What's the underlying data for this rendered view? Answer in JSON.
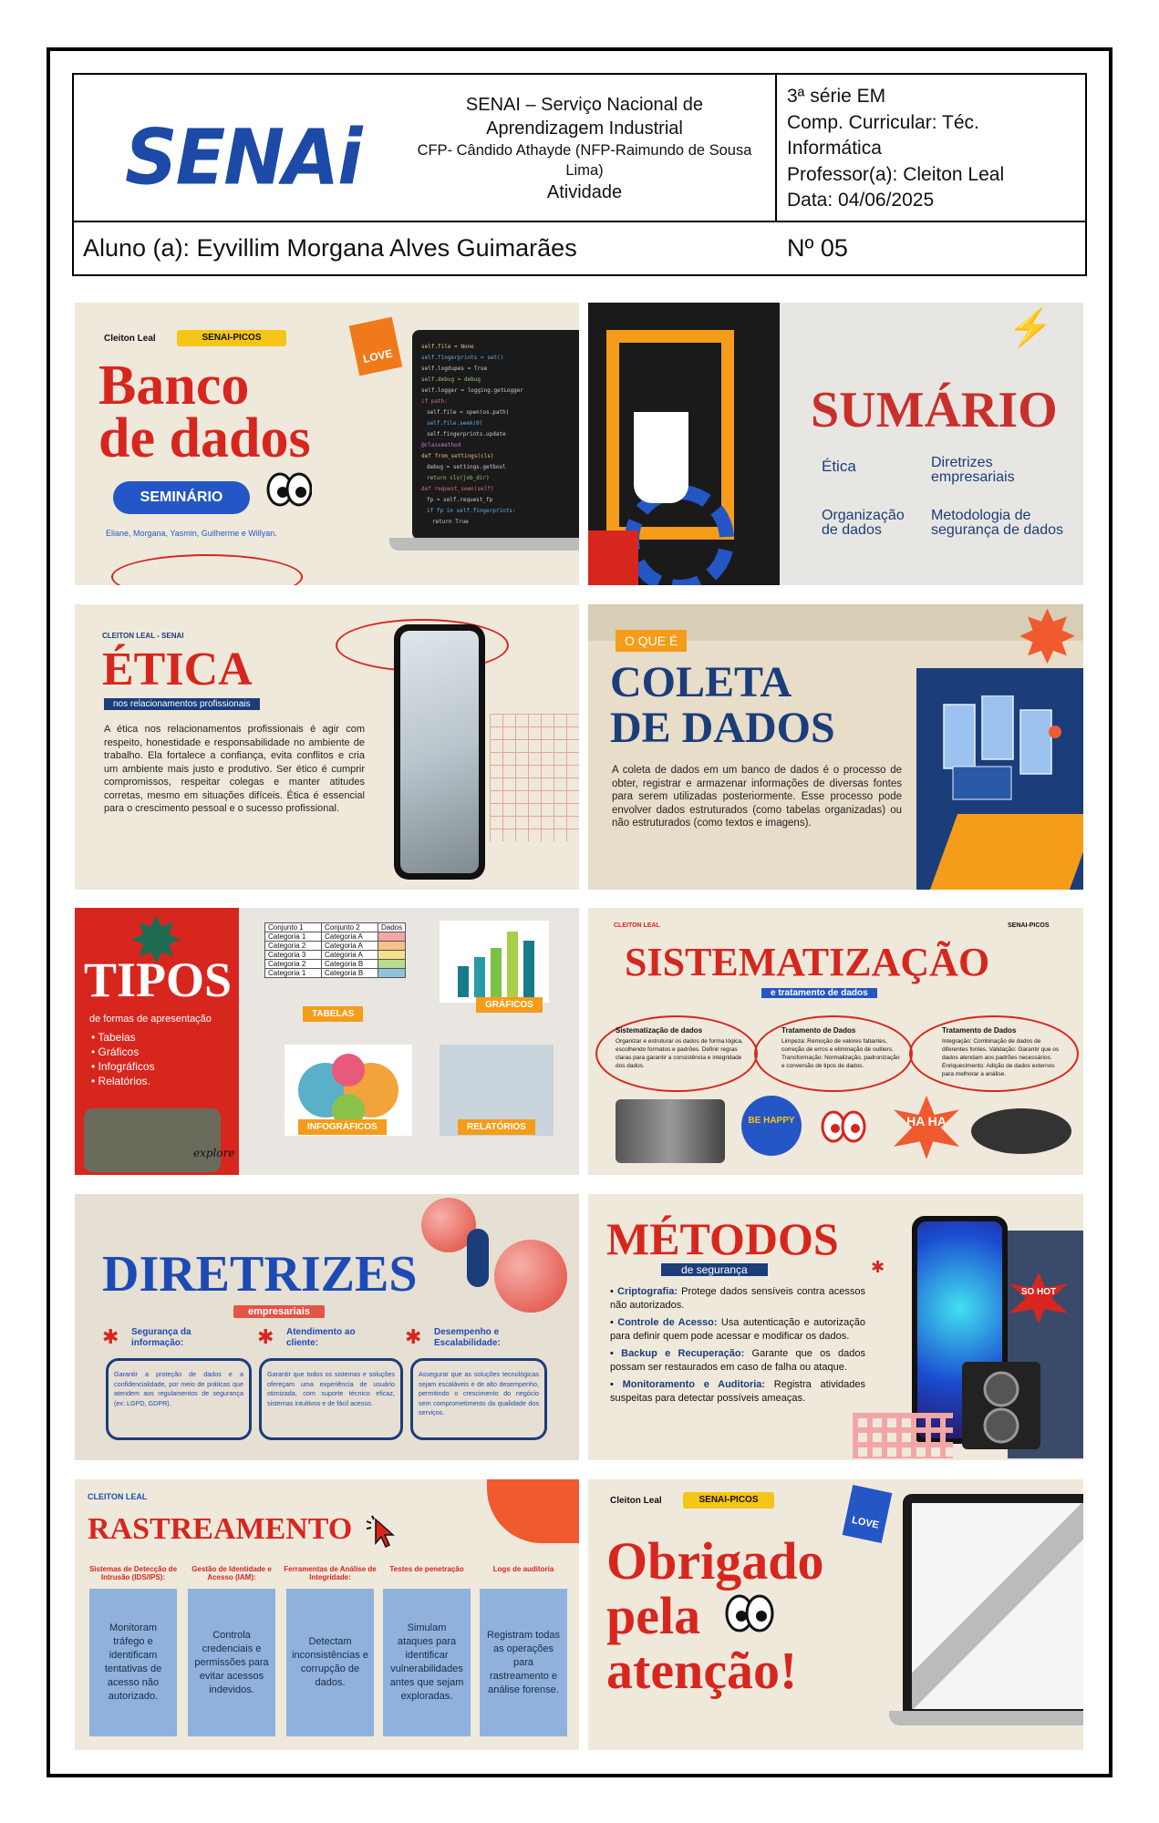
{
  "header": {
    "logo": "SENAi",
    "institution_line1": "SENAI – Serviço Nacional de",
    "institution_line2": "Aprendizagem Industrial",
    "center_line1": "CFP- Cândido Athayde (NFP-Raimundo de Sousa",
    "center_line2": "Lima)",
    "doc_type": "Atividade",
    "serie": "3ª série EM",
    "comp_line1": "Comp. Curricular: Téc.",
    "comp_line2": "Informática",
    "professor": "Professor(a): Cleiton Leal",
    "data": "Data: 04/06/2025",
    "aluno": "Aluno (a): Eyvillim Morgana Alves Guimarães",
    "numero": "Nº 05"
  },
  "slides": {
    "s1": {
      "author": "Cleiton Leal",
      "tag": "SENAI-PICOS",
      "title1": "Banco",
      "title2": "de dados",
      "pill": "SEMINÁRIO",
      "authors": "Eliane, Morgana, Yasmin, Guilherme e Willyan.",
      "sticker": "LOVE"
    },
    "s2": {
      "title": "SUMÁRIO",
      "item1": "Ética",
      "item2a": "Diretrizes",
      "item2b": "empresariais",
      "item3a": "Organização",
      "item3b": "de dados",
      "item4a": "Metodologia de",
      "item4b": "segurança de dados"
    },
    "s3": {
      "tag": "CLEITON LEAL - SENAI",
      "title": "ÉTICA",
      "subtitle": "nos relacionamentos profissionais",
      "text": "A ética nos relacionamentos profissionais é agir com respeito, honestidade e responsabilidade no ambiente de trabalho. Ela fortalece a confiança, evita conflitos e cria um ambiente mais justo e produtivo. Ser ético é cumprir compromissos, respeitar colegas e manter atitudes corretas, mesmo em situações difíceis. Ética é essencial para o crescimento pessoal e o sucesso profissional."
    },
    "s4": {
      "tag": "O QUE É",
      "title1": "COLETA",
      "title2": "DE DADOS",
      "text": "A coleta de dados em um banco de dados é o processo de obter, registrar e armazenar informações de diversas fontes para serem utilizadas posteriormente. Esse processo pode envolver dados estruturados (como tabelas organizadas) ou não estruturados (como textos e imagens)."
    },
    "s5": {
      "title": "TIPOS",
      "subtitle": "de formas de apresentação",
      "items": [
        "• Tabelas",
        "• Gráficos",
        "• Infográficos",
        "• Relatórios."
      ],
      "lbl_tabelas": "TABELAS",
      "lbl_graficos": "GRÁFICOS",
      "lbl_info": "INFOGRÁFICOS",
      "lbl_rel": "RELATÓRIOS",
      "table_head": [
        "Conjunto 1",
        "Conjunto 2",
        "Dados"
      ],
      "table_rows": [
        [
          "Categoria 1",
          "Categoria A"
        ],
        [
          "Categoria 2",
          "Categoria A"
        ],
        [
          "Categoria 3",
          "Categoria A"
        ],
        [
          "Categoria 2",
          "Categoria B"
        ],
        [
          "Categoria 1",
          "Categoria B"
        ]
      ],
      "explore": "explore"
    },
    "s6": {
      "tag_left": "CLEITON LEAL",
      "tag_right": "SENAI-PICOS",
      "title": "SISTEMATIZAÇÃO",
      "subtitle": "e tratamento de dados",
      "c1_title": "Sistematização de dados",
      "c1_text": "Organizar e estruturar os dados de forma lógica, escolhendo formatos e padrões. Definir regras claras para garantir a consistência e integridade dos dados.",
      "c2_title": "Tratamento de Dados",
      "c2_text": "Limpeza: Remoção de valores faltantes, correção de erros e eliminação de outliers. Transformação: Normalização, padronização e conversão de tipos de dados.",
      "c3_title": "Tratamento de Dados",
      "c3_text": "Integração: Combinação de dados de diferentes fontes. Validação: Garantir que os dados atendam aos padrões necessários. Enriquecimento: Adição de dados externos para melhorar a análise.",
      "happy": "BE HAPPY",
      "haha": "HA HA"
    },
    "s7": {
      "title": "DIRETRIZES",
      "subtitle": "empresariais",
      "h1a": "Segurança da",
      "h1b": "informação:",
      "t1": "Garantir a proteção de dados e a confidencialidade, por meio de práticas que atendem aos regulamentos de segurança (ex: LGPD, GDPR).",
      "h2a": "Atendimento ao",
      "h2b": "cliente:",
      "t2": "Garantir que todos os sistemas e soluções ofereçam uma experiência de usuário otimizada, com suporte técnico eficaz, sistemas intuitivos e de fácil acesso.",
      "h3a": "Desempenho e",
      "h3b": "Escalabilidade:",
      "t3": "Assegurar que as soluções tecnológicas sejam escaláveis e de alto desempenho, permitindo o crescimento do negócio sem comprometimento da qualidade dos serviços."
    },
    "s8": {
      "title": "MÉTODOS",
      "subtitle": "de segurança",
      "b1": "Criptografia:",
      "t1": " Protege dados sensíveis contra acessos não autorizados.",
      "b2": "Controle de Acesso:",
      "t2": " Usa autenticação e autorização para definir quem pode acessar e modificar os dados.",
      "b3": "Backup e Recuperação:",
      "t3": " Garante que os dados possam ser restaurados em caso de falha ou ataque.",
      "b4": "Monitoramento e Auditoria:",
      "t4": " Registra atividades suspeitas para detectar possíveis ameaças.",
      "sticker": "SO HOT"
    },
    "s9": {
      "tag": "CLEITON LEAL",
      "title": "RASTREAMENTO",
      "cols": [
        {
          "head": "Sistemas de Detecção de Intrusão (IDS/IPS):",
          "body": "Monitoram tráfego e identificam tentativas de acesso não autorizado."
        },
        {
          "head": "Gestão de Identidade e Acesso (IAM):",
          "body": "Controla credenciais e permissões para evitar acessos indevidos."
        },
        {
          "head": "Ferramentas de Análise de Integridade:",
          "body": "Detectam inconsistências e corrupção de dados."
        },
        {
          "head": "Testes de penetração",
          "body": "Simulam ataques para identificar vulnerabilidades antes que sejam exploradas."
        },
        {
          "head": "Logs de auditoria",
          "body": "Registram todas as operações para rastreamento e análise forense."
        }
      ]
    },
    "s10": {
      "author": "Cleiton Leal",
      "tag": "SENAI-PICOS",
      "t1": "Obrigado",
      "t2": "pela",
      "t3": "atenção!",
      "sticker": "LOVE"
    }
  }
}
